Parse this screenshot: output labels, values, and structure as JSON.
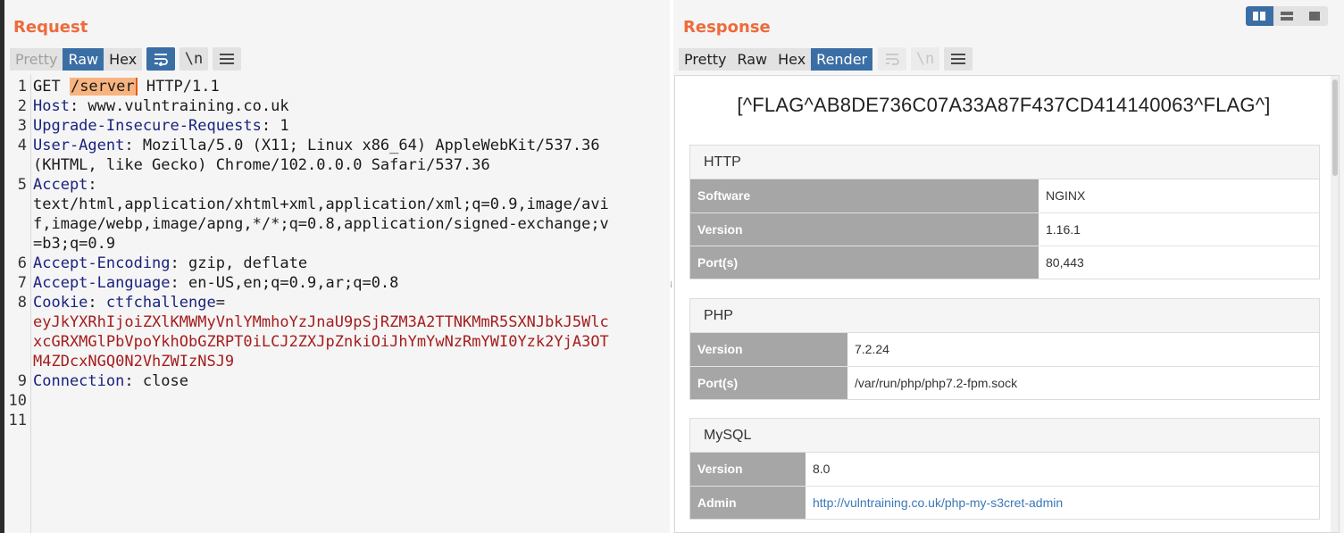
{
  "request": {
    "title": "Request",
    "tabs": [
      {
        "label": "Pretty",
        "state": "disabled"
      },
      {
        "label": "Raw",
        "state": "active"
      },
      {
        "label": "Hex",
        "state": "normal"
      }
    ],
    "tools": [
      {
        "name": "wrap-toggle-button",
        "glyph": "⮓",
        "on": true
      },
      {
        "name": "newline-toggle-button",
        "glyph": "\\n",
        "on": false
      },
      {
        "name": "menu-button",
        "glyph": "☰",
        "on": false
      }
    ],
    "line_numbers": [
      "1",
      "2",
      "3",
      "4",
      "",
      "5",
      "",
      "",
      "",
      "6",
      "7",
      "8",
      "",
      "",
      "",
      "9",
      "10",
      "11"
    ],
    "lines": {
      "l1_method": "GET ",
      "l1_path": "/server",
      "l1_proto": " HTTP/1.1",
      "l2_key": "Host",
      "l2_val": ": www.vulntraining.co.uk",
      "l3_key": "Upgrade-Insecure-Requests",
      "l3_val": ": 1",
      "l4_key": "User-Agent",
      "l4_val": ": Mozilla/5.0 (X11; Linux x86_64) AppleWebKit/537.36",
      "l4_cont": "(KHTML, like Gecko) Chrome/102.0.0.0 Safari/537.36",
      "l5_key": "Accept",
      "l5_val": ":",
      "l5_c1": "text/html,application/xhtml+xml,application/xml;q=0.9,image/avi",
      "l5_c2": "f,image/webp,image/apng,*/*;q=0.8,application/signed-exchange;v",
      "l5_c3": "=b3;q=0.9",
      "l6_key": "Accept-Encoding",
      "l6_val": ": gzip, deflate",
      "l7_key": "Accept-Language",
      "l7_val": ": en-US,en;q=0.9,ar;q=0.8",
      "l8_key": "Cookie",
      "l8_sep": ": ",
      "l8_cname": "ctfchallenge",
      "l8_eq": "=",
      "l8_v1": "eyJkYXRhIjoiZXlKMWMyVnlYMmhoYzJnaU9pSjRZM3A2TTNKMmR5SXNJbkJ5Wlc",
      "l8_v2": "xcGRXMGlPbVpoYkhObGZRPT0iLCJ2ZXJpZnkiOiJhYmYwNzRmYWI0Yzk2YjA3OT",
      "l8_v3": "M4ZDcxNGQ0N2VhZWIzNSJ9",
      "l9_key": "Connection",
      "l9_val": ": close"
    }
  },
  "response": {
    "title": "Response",
    "tabs": [
      {
        "label": "Pretty",
        "state": "normal"
      },
      {
        "label": "Raw",
        "state": "normal"
      },
      {
        "label": "Hex",
        "state": "normal"
      },
      {
        "label": "Render",
        "state": "active"
      }
    ],
    "flag": "[^FLAG^AB8DE736C07A33A87F437CD414140063^FLAG^]",
    "panels": {
      "http": {
        "title": "HTTP",
        "rows": [
          {
            "k": "Software",
            "v": "NGINX"
          },
          {
            "k": "Version",
            "v": "1.16.1"
          },
          {
            "k": "Port(s)",
            "v": "80,443"
          }
        ]
      },
      "php": {
        "title": "PHP",
        "rows": [
          {
            "k": "Version",
            "v": "7.2.24"
          },
          {
            "k": "Port(s)",
            "v": "/var/run/php/php7.2-fpm.sock"
          }
        ]
      },
      "mysql": {
        "title": "MySQL",
        "rows": [
          {
            "k": "Version",
            "v": "8.0"
          },
          {
            "k": "Admin",
            "v": "http://vulntraining.co.uk/php-my-s3cret-admin"
          }
        ]
      }
    }
  },
  "colors": {
    "accent_title": "#ee6b3b",
    "active_tab": "#3a6ea5",
    "header_key": "#1a237e",
    "cookie_value": "#a51d1d",
    "highlight": "#f8b47f",
    "table_key_bg": "#a6a6a6",
    "link": "#3a78b8"
  }
}
